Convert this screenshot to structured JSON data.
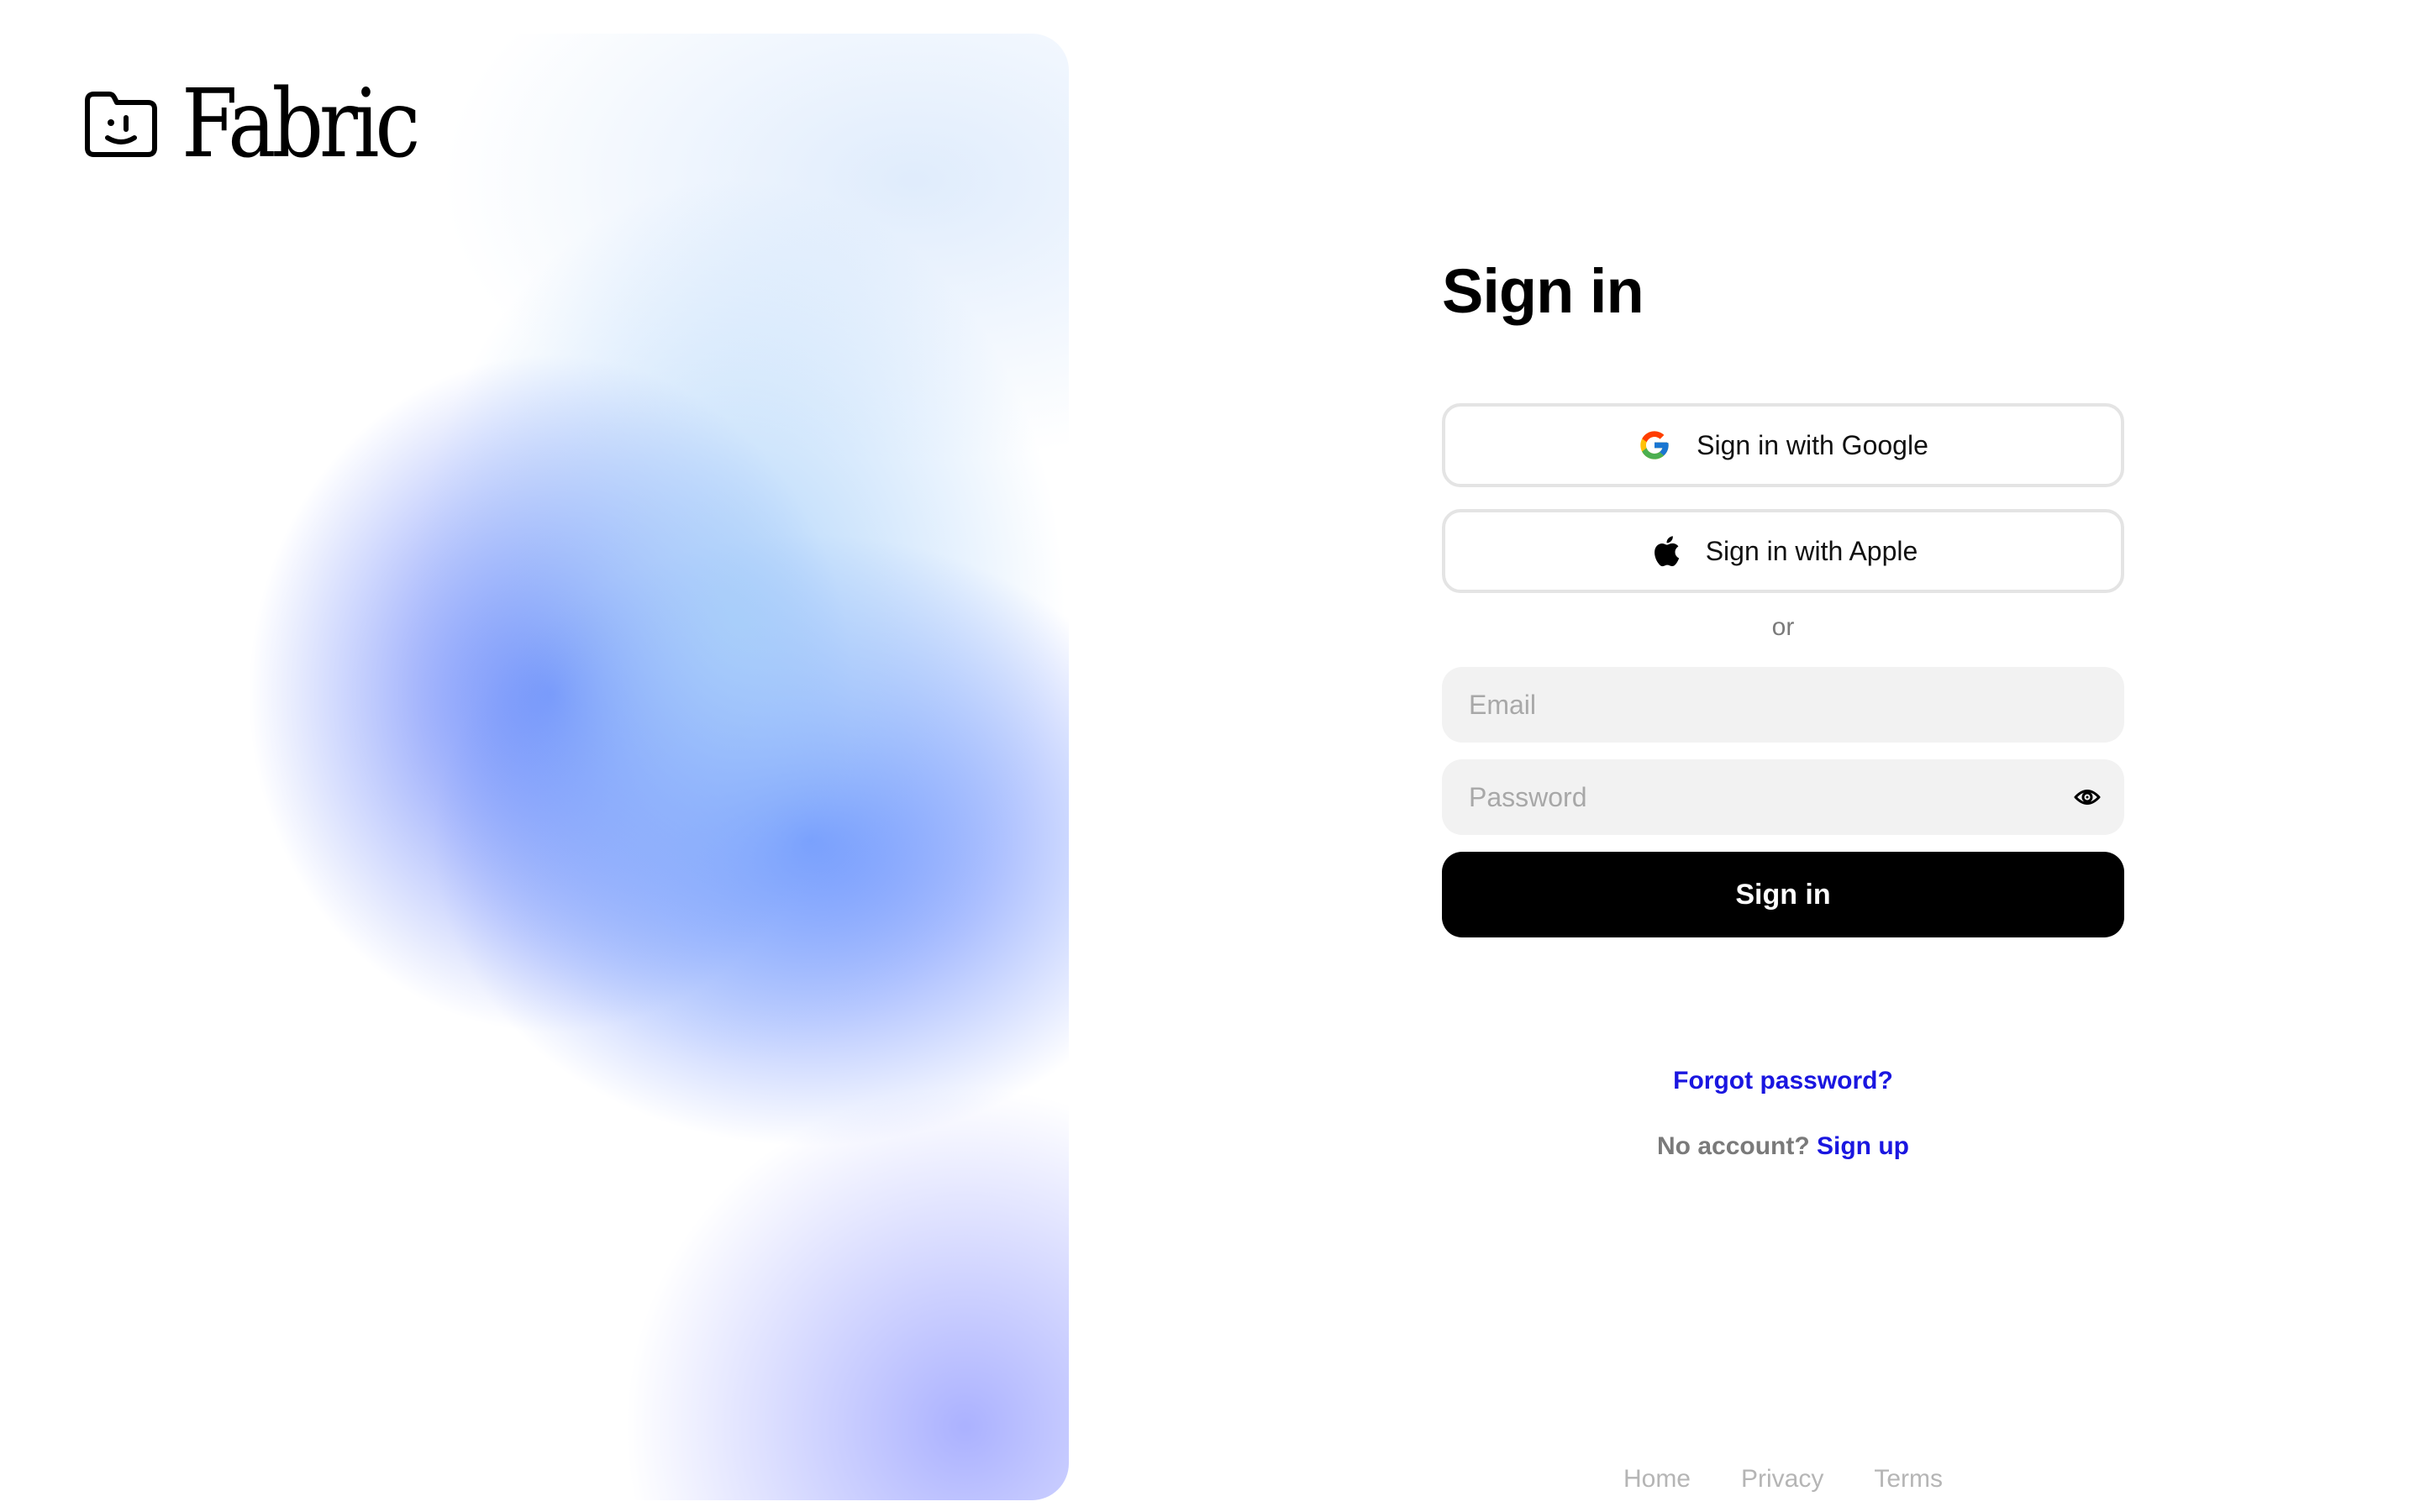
{
  "brand": {
    "name": "Fabric"
  },
  "signin": {
    "title": "Sign in",
    "google_label": "Sign in with Google",
    "apple_label": "Sign in with Apple",
    "divider_label": "or",
    "email_placeholder": "Email",
    "password_placeholder": "Password",
    "submit_label": "Sign in",
    "forgot_label": "Forgot password?",
    "no_account_label": "No account?",
    "signup_label": "Sign up"
  },
  "footer": {
    "links": [
      "Home",
      "Privacy",
      "Terms"
    ]
  },
  "icons": {
    "logo": "folder-face-icon",
    "google": "google-icon",
    "apple": "apple-icon",
    "show_password": "eye-icon"
  },
  "colors": {
    "link": "#1a16e0",
    "primary_button": "#000000",
    "field_background": "#f2f2f2",
    "muted_text": "#7a7a7a",
    "footer_text": "#b5b5b5",
    "gradient_blue": "#527aff"
  }
}
